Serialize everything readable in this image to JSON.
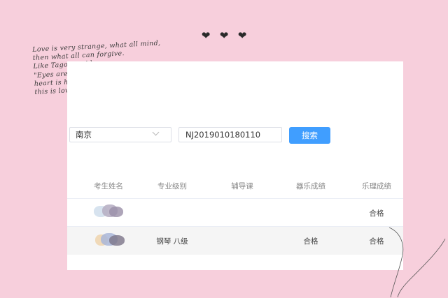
{
  "decor": {
    "hearts": [
      "❤",
      "❤",
      "❤"
    ],
    "poem": [
      "Love is very strange, what all mind,",
      "then what all can forgive.",
      "Like Tagore said,",
      "\"Eyes are raining for her,",
      "heart is holding umbrella for her,",
      "this is love."
    ]
  },
  "search": {
    "city_value": "南京",
    "id_value": "NJ2019010180110",
    "button_label": "搜索"
  },
  "table": {
    "headers": [
      "考生姓名",
      "专业级别",
      "辅导课",
      "器乐成绩",
      "乐理成绩"
    ],
    "rows": [
      {
        "level": "",
        "tutoring": "",
        "instrument_score": "",
        "theory_score": "合格"
      },
      {
        "level": "钢琴  八级",
        "tutoring": "",
        "instrument_score": "合格",
        "theory_score": "合格"
      }
    ]
  },
  "colors": {
    "background": "#f7cfdc",
    "accent": "#409eff"
  }
}
